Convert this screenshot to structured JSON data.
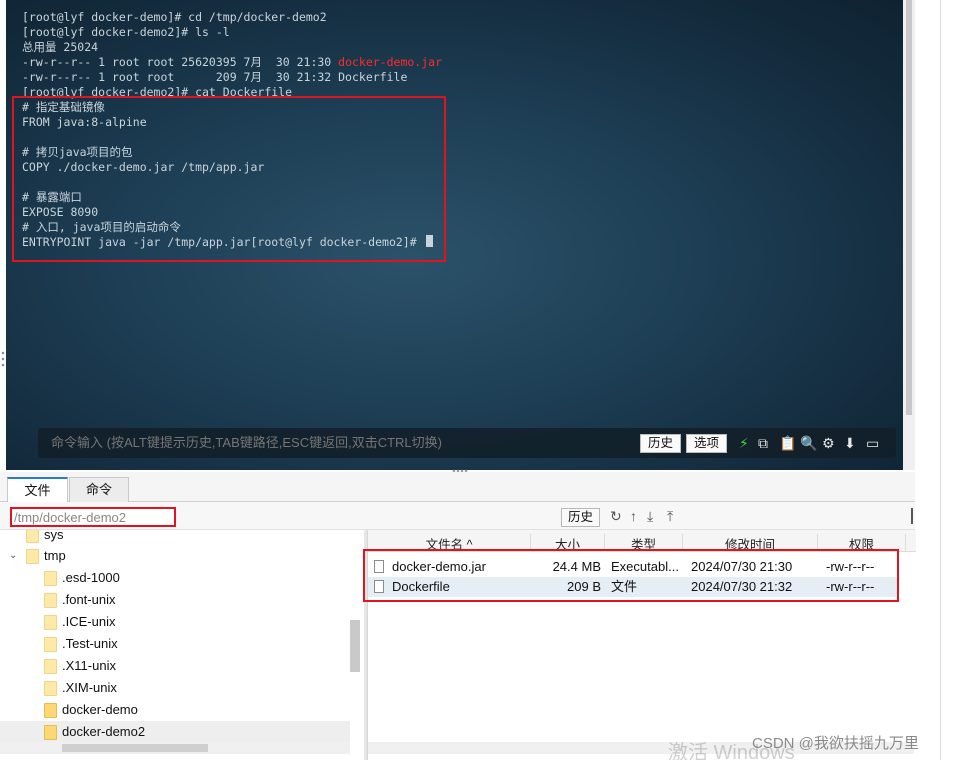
{
  "terminal": {
    "lines": [
      "[root@lyf docker-demo]# cd /tmp/docker-demo2",
      "[root@lyf docker-demo2]# ls -l",
      "总用量 25024",
      "-rw-r--r-- 1 root root 25620395 7月  30 21:30 ",
      "-rw-r--r-- 1 root root      209 7月  30 21:32 Dockerfile",
      "[root@lyf docker-demo2]# cat Dockerfile",
      "# 指定基础镜像",
      "FROM java:8-alpine",
      "",
      "# 拷贝java项目的包",
      "COPY ./docker-demo.jar /tmp/app.jar",
      "",
      "# 暴露端口",
      "EXPOSE 8090",
      "# 入口, java项目的启动命令",
      "ENTRYPOINT java -jar /tmp/app.jar[root@lyf docker-demo2]# "
    ],
    "red_filename": "docker-demo.jar"
  },
  "cmdbar": {
    "placeholder": "命令输入 (按ALT键提示历史,TAB键路径,ESC键返回,双击CTRL切换)",
    "history_label": "历史",
    "select_label": "选项",
    "icons": [
      "lightning-icon",
      "copy-icon",
      "paste-icon",
      "search-icon",
      "gear-icon",
      "download-icon",
      "maximize-icon"
    ]
  },
  "tabs": [
    {
      "label": "文件",
      "active": true
    },
    {
      "label": "命令",
      "active": false
    }
  ],
  "path": {
    "value": "/tmp/docker-demo2",
    "history_label": "历史",
    "icons": [
      "refresh-icon",
      "up-icon",
      "download-icon",
      "upload-icon"
    ]
  },
  "tree": {
    "items": [
      {
        "label": "sys",
        "level": 1
      },
      {
        "label": "tmp",
        "level": 0,
        "expanded": true
      },
      {
        "label": ".esd-1000",
        "level": 1
      },
      {
        "label": ".font-unix",
        "level": 1
      },
      {
        "label": ".ICE-unix",
        "level": 1
      },
      {
        "label": ".Test-unix",
        "level": 1
      },
      {
        "label": ".X11-unix",
        "level": 1
      },
      {
        "label": ".XIM-unix",
        "level": 1
      },
      {
        "label": "docker-demo",
        "level": 1
      },
      {
        "label": "docker-demo2",
        "level": 1,
        "selected": true
      }
    ]
  },
  "files": {
    "headers": [
      "文件名",
      "大小",
      "类型",
      "修改时间",
      "权限"
    ],
    "sort_indicator": "^",
    "rows": [
      {
        "name": "docker-demo.jar",
        "size": "24.4 MB",
        "type": "Executabl...",
        "modified": "2024/07/30 21:30",
        "perm": "-rw-r--r--"
      },
      {
        "name": "Dockerfile",
        "size": "209 B",
        "type": "文件",
        "modified": "2024/07/30 21:32",
        "perm": "-rw-r--r--"
      }
    ]
  },
  "watermark": {
    "activate": "激活 Windows",
    "csdn": "CSDN @我欲扶摇九万里"
  },
  "colors": {
    "highlight": "#e0141e",
    "terminal_text": "#c9d4da",
    "tab_accent": "#2a78d4"
  }
}
